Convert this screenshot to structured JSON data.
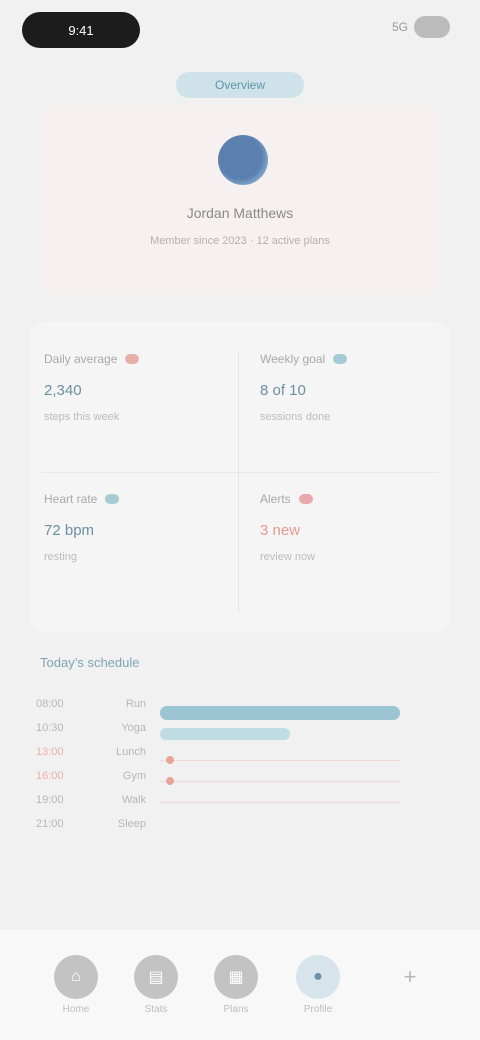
{
  "status": {
    "time": "9:41",
    "right": "5G"
  },
  "header": {
    "tag": "Overview"
  },
  "profile": {
    "name": "Jordan Matthews",
    "subtitle": "Member since 2023 · 12 active plans"
  },
  "stats": [
    {
      "label": "Daily average",
      "value": "2,340",
      "note": "steps this week"
    },
    {
      "label": "Weekly goal",
      "value": "8 of 10",
      "note": "sessions done"
    },
    {
      "label": "Heart rate",
      "value": "72 bpm",
      "note": "resting"
    },
    {
      "label": "Alerts",
      "value": "3 new",
      "note": "review now"
    }
  ],
  "timeline": {
    "title": "Today’s schedule",
    "rows": [
      {
        "time": "08:00",
        "label": "Run"
      },
      {
        "time": "10:30",
        "label": "Yoga"
      },
      {
        "time": "13:00",
        "label": "Lunch"
      },
      {
        "time": "16:00",
        "label": "Gym"
      },
      {
        "time": "19:00",
        "label": "Walk"
      },
      {
        "time": "21:00",
        "label": "Sleep"
      }
    ]
  },
  "nav": [
    {
      "label": "Home"
    },
    {
      "label": "Stats"
    },
    {
      "label": "Plans"
    },
    {
      "label": "Profile"
    }
  ],
  "colors": {
    "accent": "#6b8fa3",
    "card_bg": "#f7f0f0",
    "alert": "#e6a59a"
  }
}
